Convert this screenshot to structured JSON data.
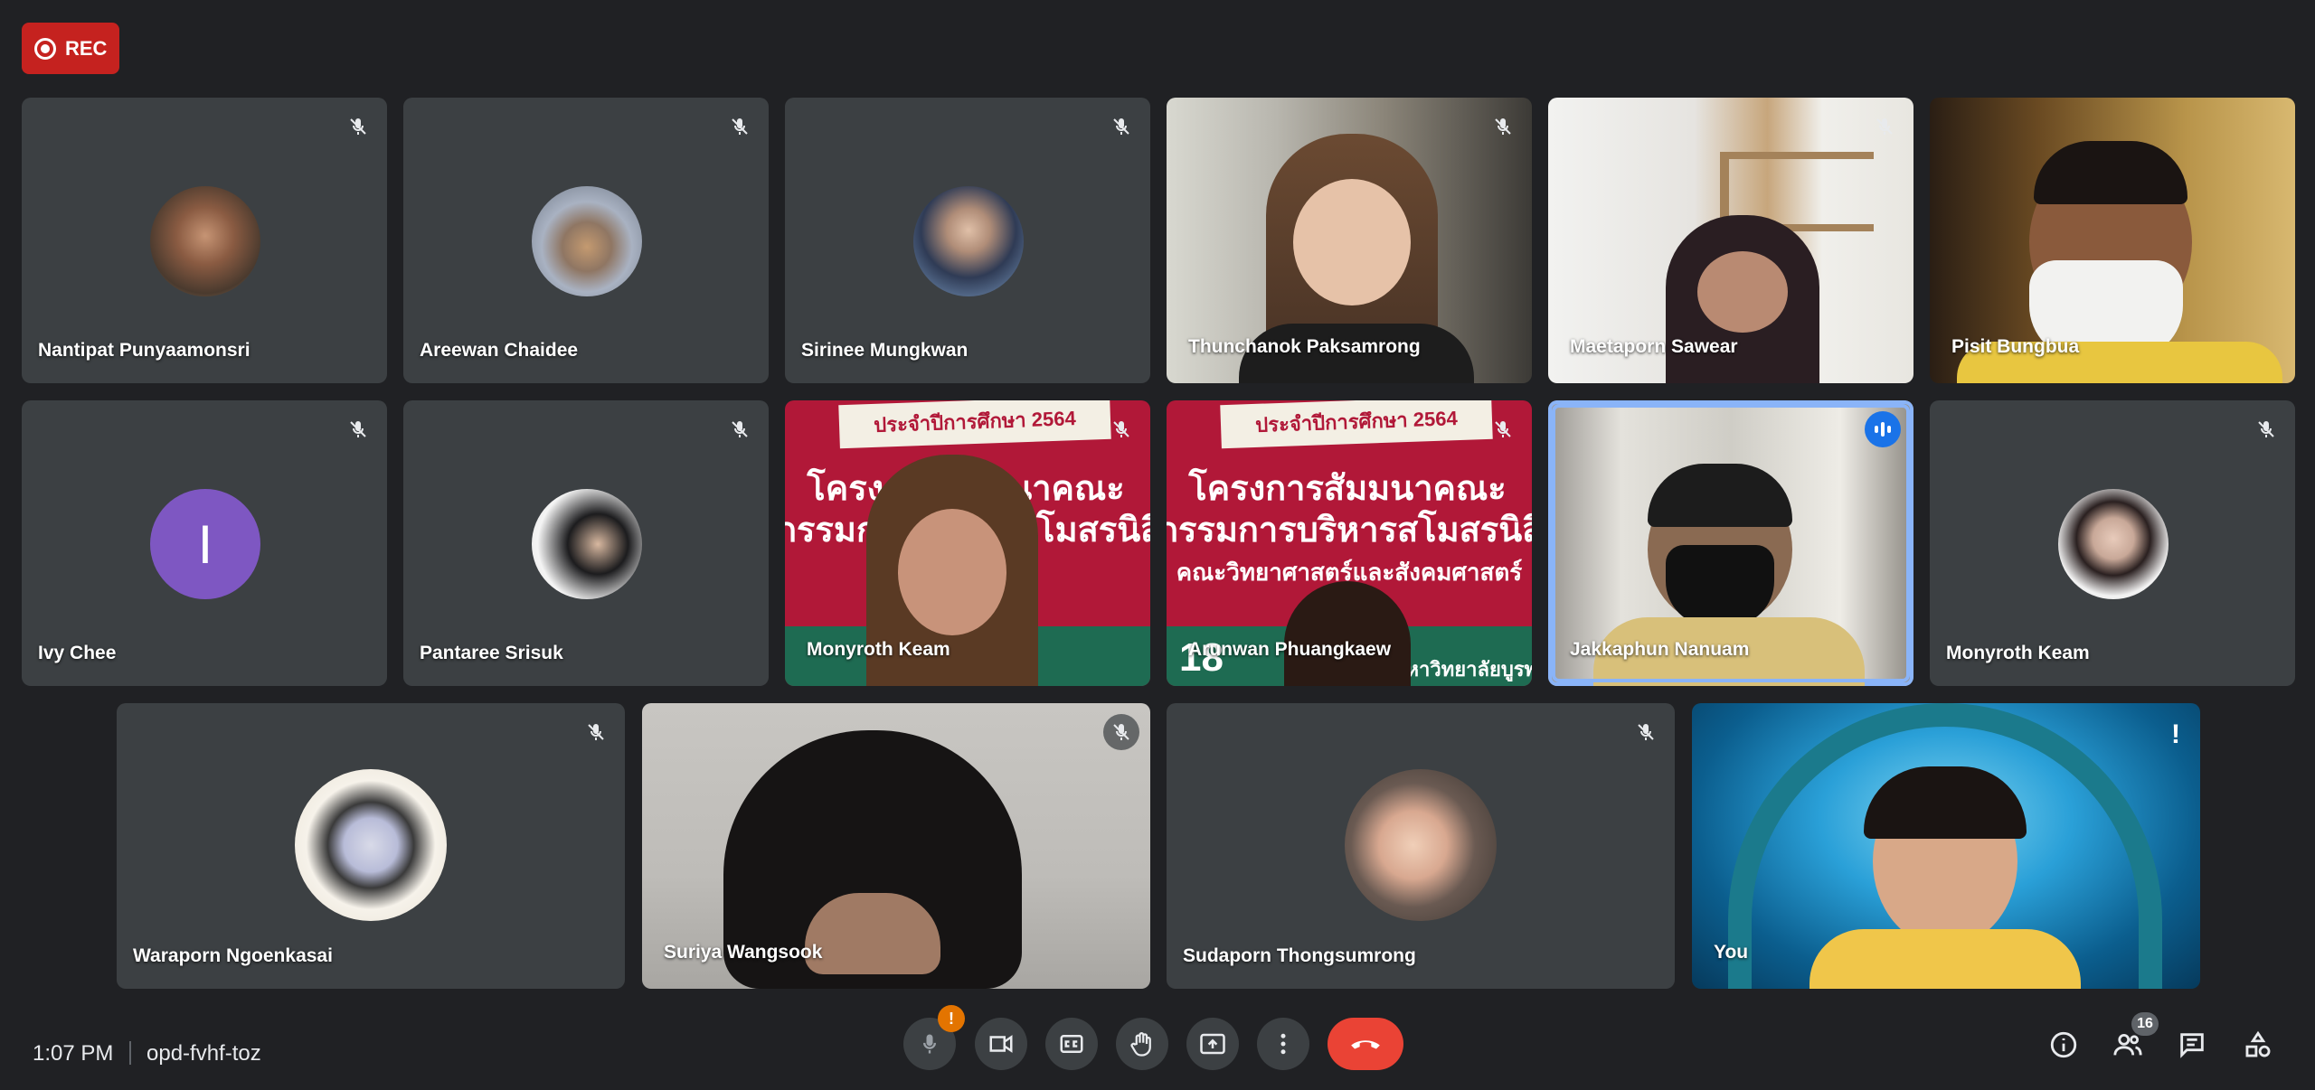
{
  "recording": {
    "label": "REC"
  },
  "participants": [
    {
      "name": "Nantipat Punyaamonsri",
      "muted": true
    },
    {
      "name": "Areewan Chaidee",
      "muted": true
    },
    {
      "name": "Sirinee Mungkwan",
      "muted": true
    },
    {
      "name": "Thunchanok Paksamrong",
      "muted": true
    },
    {
      "name": "Maetaporn Sawear",
      "muted": true
    },
    {
      "name": "Pisit Bungbua",
      "muted": false
    },
    {
      "name": "Ivy Chee",
      "muted": true,
      "initial": "I"
    },
    {
      "name": "Pantaree Srisuk",
      "muted": true
    },
    {
      "name": "Monyroth Keam",
      "muted": true
    },
    {
      "name": "Arunwan Phuangkaew",
      "muted": true
    },
    {
      "name": "Jakkaphun Nanuam",
      "speaking": true
    },
    {
      "name": "Monyroth Keam",
      "muted": true
    },
    {
      "name": "Waraporn Ngoenkasai",
      "muted": true
    },
    {
      "name": "Suriya Wangsook",
      "muted": true
    },
    {
      "name": "Sudaporn Thongsumrong",
      "muted": true
    },
    {
      "name": "You",
      "warning": "!"
    }
  ],
  "banner": {
    "line1": "ประจำปีการศึกษา 2564",
    "line2": "โครงการสัมมนาคณะ",
    "line3": "กรรมการบริหารสโมสรนิสิต",
    "line4": "คณะวิทยาศาสตร์และสังคมศาสตร์",
    "line5": "18",
    "line6": "มหาวิทยาลัยบูรพา"
  },
  "meeting": {
    "time": "1:07 PM",
    "code": "opd-fvhf-toz"
  },
  "controls": {
    "mic_warning": "!"
  },
  "people_count": "16",
  "colors": {
    "background": "#202124",
    "tile": "#3c4043",
    "accent": "#8ab4f8",
    "end_call": "#ea4335",
    "rec": "#c5221f",
    "warning": "#e37400"
  }
}
